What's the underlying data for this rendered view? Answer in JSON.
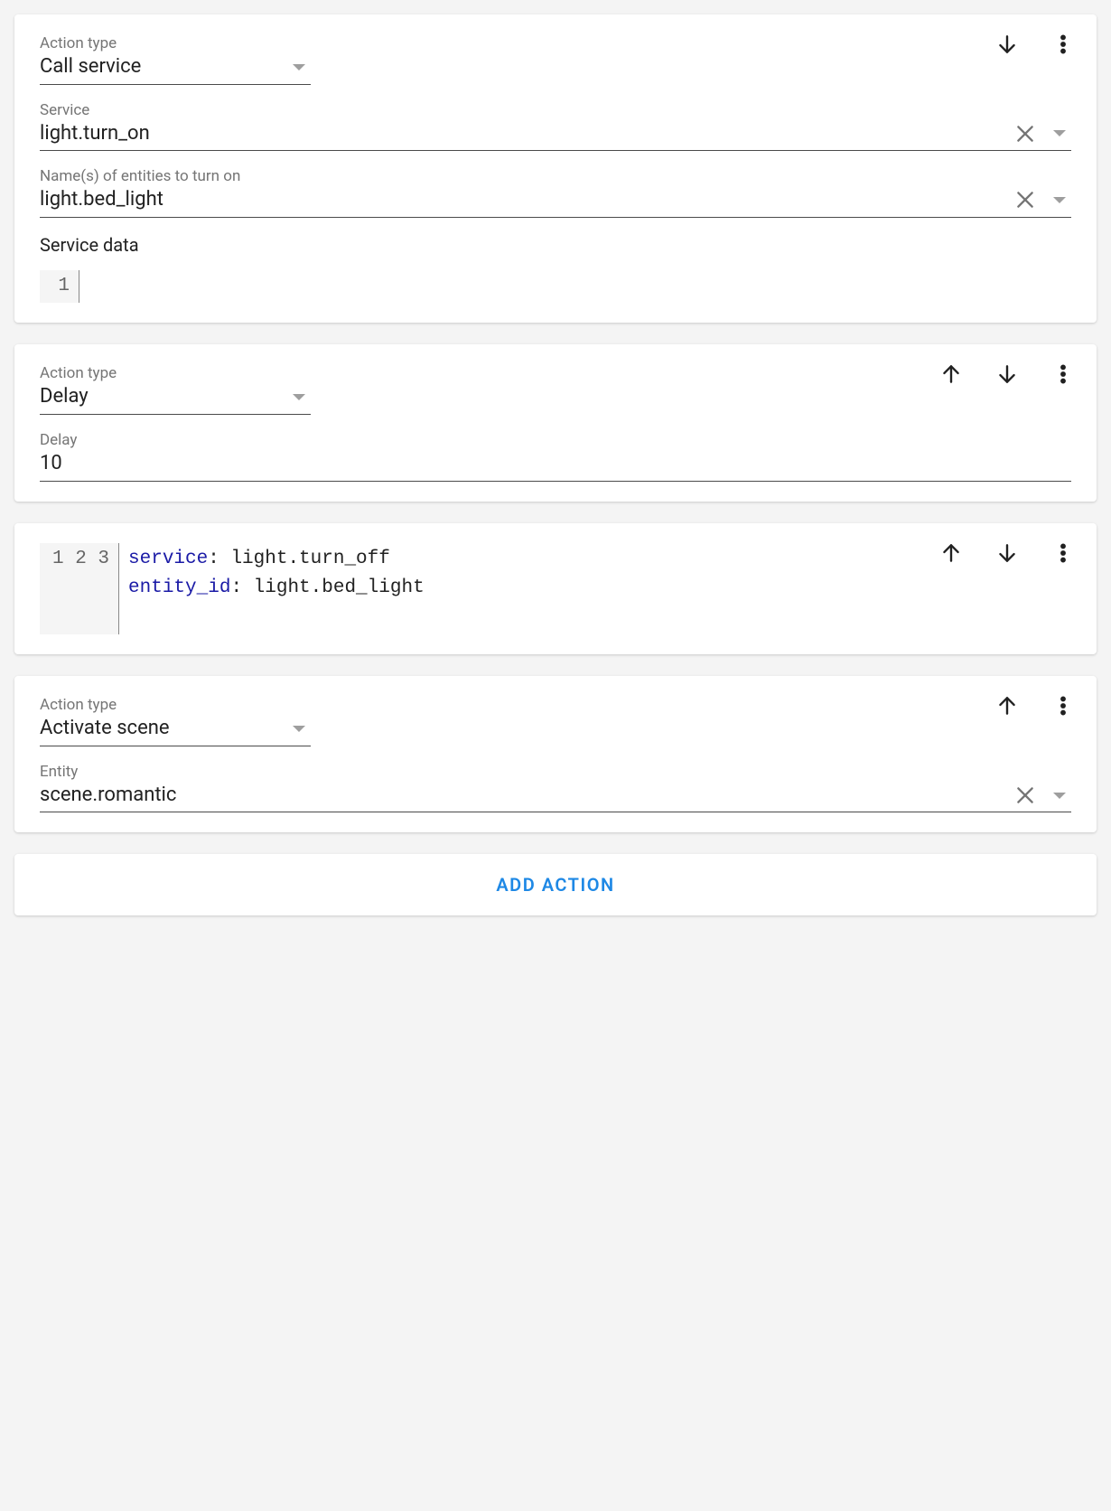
{
  "labels": {
    "action_type": "Action type",
    "service": "Service",
    "entities": "Name(s) of entities to turn on",
    "service_data": "Service data",
    "delay": "Delay",
    "entity": "Entity"
  },
  "cards": [
    {
      "action_type": "Call service",
      "service": "light.turn_on",
      "entities_value": "light.bed_light",
      "code_gutter": "1",
      "code_body": ""
    },
    {
      "action_type": "Delay",
      "delay_value": "10"
    },
    {
      "yaml_lines": [
        {
          "n": "1",
          "key": "service",
          "sep": ": ",
          "val": "light.turn_off"
        },
        {
          "n": "2",
          "key": "entity_id",
          "sep": ": ",
          "val": "light.bed_light"
        },
        {
          "n": "3",
          "key": "",
          "sep": "",
          "val": ""
        }
      ]
    },
    {
      "action_type": "Activate scene",
      "entity_value": "scene.romantic"
    }
  ],
  "add_action": "ADD ACTION"
}
